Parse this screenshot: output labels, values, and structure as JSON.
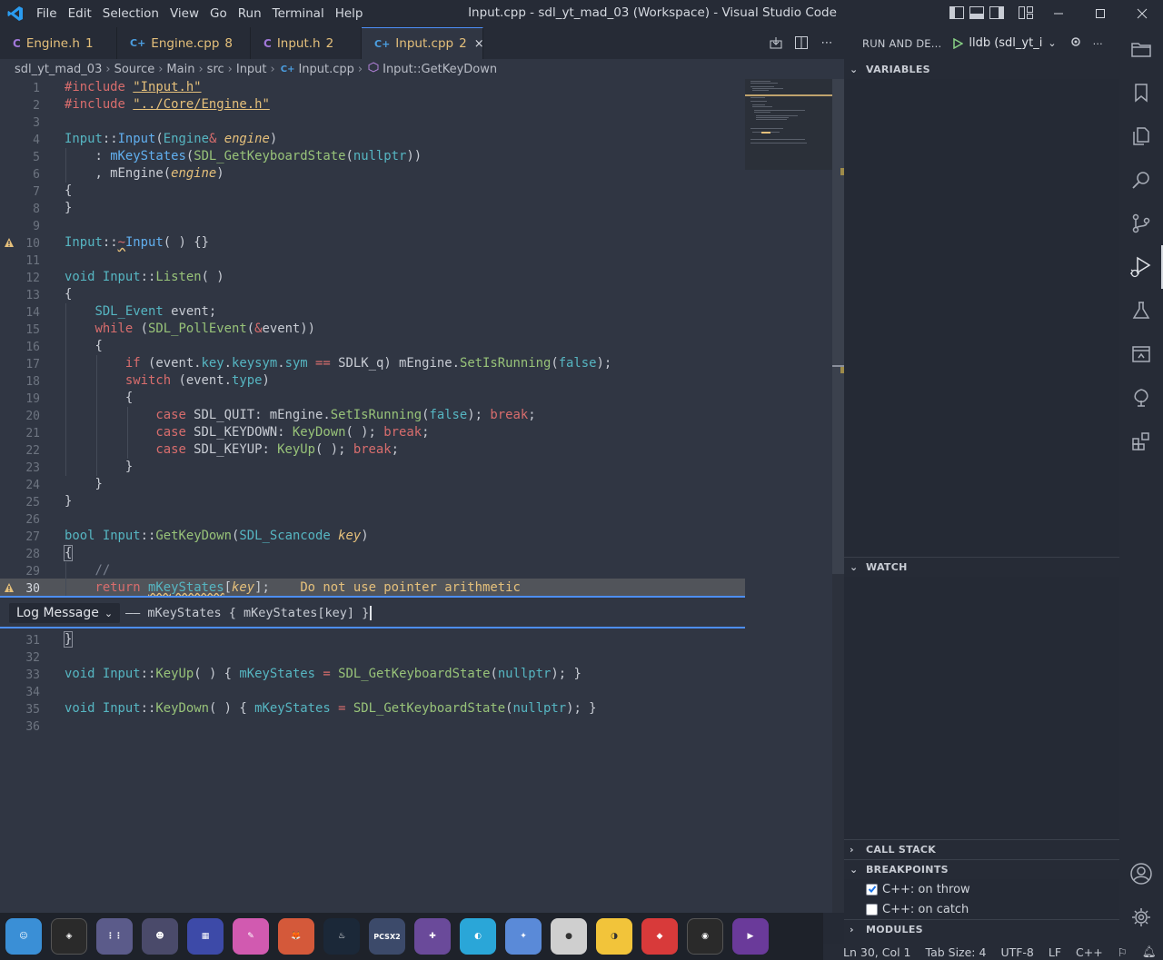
{
  "titlebar": {
    "menu": [
      "File",
      "Edit",
      "Selection",
      "View",
      "Go",
      "Run",
      "Terminal",
      "Help"
    ],
    "title": "Input.cpp - sdl_yt_mad_03 (Workspace) - Visual Studio Code"
  },
  "tabs": [
    {
      "icon": "C",
      "name": "Engine.h",
      "count": "1"
    },
    {
      "icon": "C+",
      "name": "Engine.cpp",
      "count": "8"
    },
    {
      "icon": "C",
      "name": "Input.h",
      "count": "2"
    },
    {
      "icon": "C+",
      "name": "Input.cpp",
      "count": "2",
      "close": "×"
    }
  ],
  "breadcrumb": [
    "sdl_yt_mad_03",
    "Source",
    "Main",
    "src",
    "Input",
    "Input.cpp",
    "Input::GetKeyDown"
  ],
  "editor": {
    "line_numbers": [
      "1",
      "2",
      "3",
      "4",
      "5",
      "6",
      "7",
      "8",
      "9",
      "10",
      "11",
      "12",
      "13",
      "14",
      "15",
      "16",
      "17",
      "18",
      "19",
      "20",
      "21",
      "22",
      "23",
      "24",
      "25",
      "26",
      "27",
      "28",
      "29",
      "30",
      "31",
      "32",
      "33",
      "34",
      "35",
      "36"
    ],
    "inline_hint": "Do not use pointer arithmetic",
    "logpoint": {
      "mode": "Log Message",
      "value": "—— mKeyStates { mKeyStates[key] }"
    }
  },
  "debug": {
    "title": "RUN AND DE...",
    "config": "lldb (sdl_yt_i",
    "sections": {
      "variables": "VARIABLES",
      "watch": "WATCH",
      "call_stack": "CALL STACK",
      "breakpoints": "BREAKPOINTS",
      "modules": "MODULES"
    },
    "breakpoints": [
      {
        "label": "C++: on throw",
        "checked": true
      },
      {
        "label": "C++: on catch",
        "checked": false
      }
    ]
  },
  "dock": [
    "Finder",
    "Unity",
    "Apps",
    "Emulator",
    "Tetris",
    "Krita",
    "GIMP",
    "Steam",
    "PCSX2",
    "Add",
    "Dolphin",
    "PPSSPP",
    "bsnes",
    "Citra",
    "Ryujinx",
    "OBS",
    "Video"
  ],
  "status": {
    "position": "Ln 30, Col 1",
    "tab_size": "Tab Size: 4",
    "encoding": "UTF-8",
    "eol": "LF",
    "language": "C++"
  },
  "colors": {
    "accent": "#4d8ef7",
    "warning": "#e5c07b"
  }
}
